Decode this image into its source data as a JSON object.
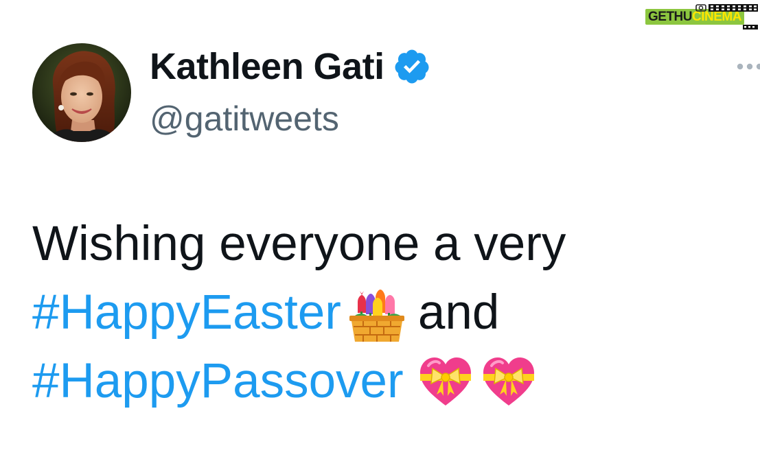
{
  "watermark": {
    "text_part1": "GETHU",
    "text_part2": "CINEMA"
  },
  "tweet": {
    "author": {
      "display_name": "Kathleen Gati",
      "handle": "@gatitweets",
      "verified": true,
      "avatar_icon": "avatar-photo"
    },
    "more_icon": "more-horizontal-icon",
    "body": {
      "line1": "Wishing everyone a very",
      "hashtag1": "#HappyEaster",
      "emoji1": "tulip-basket-emoji",
      "conjunction": "and",
      "hashtag2": "#HappyPassover",
      "emoji2": "heart-with-ribbon-emoji",
      "emoji3": "heart-with-ribbon-emoji"
    }
  },
  "colors": {
    "text_primary": "#0f1419",
    "text_secondary": "#536471",
    "link": "#1d9bf0",
    "verified_badge": "#1d9bf0",
    "watermark_green": "#8cc63f",
    "watermark_yellow": "#ffe600"
  }
}
